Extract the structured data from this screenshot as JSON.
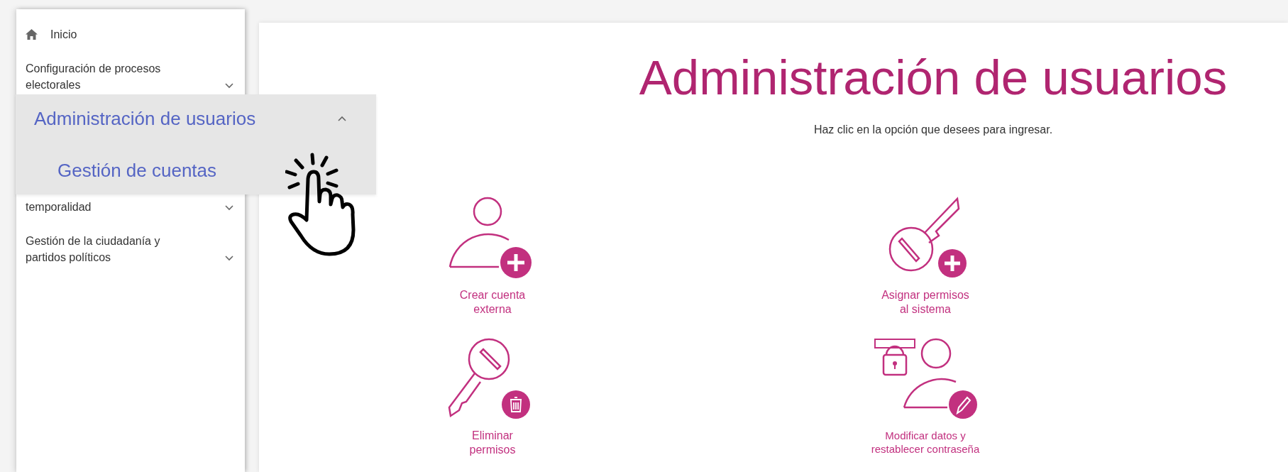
{
  "sidebar": {
    "items": [
      {
        "label": "Inicio",
        "kind": "home"
      },
      {
        "label": "Configuración de procesos electorales",
        "kind": "group",
        "expanded": false
      },
      {
        "label": "temporalidad",
        "kind": "covered-group",
        "expanded": false
      },
      {
        "label": "Gestión de la ciudadanía y partidos políticos",
        "kind": "group",
        "expanded": false
      }
    ]
  },
  "zoom_callout": {
    "item": {
      "label": "Administración de usuarios",
      "expanded": true
    },
    "subitems": [
      {
        "label": "Gestión de cuentas"
      }
    ]
  },
  "main": {
    "title": "Administración de usuarios",
    "subtitle": "Haz clic en la opción que desees para ingresar.",
    "options": [
      {
        "label": "Crear cuenta\nexterna",
        "kind": "user-add"
      },
      {
        "label": "Asignar permisos\nal sistema",
        "kind": "key-add"
      },
      {
        "label": "Eliminar\npermisos",
        "kind": "key-delete"
      },
      {
        "label": "Modificar datos y\nrestablecer contraseña",
        "kind": "user-edit"
      }
    ]
  }
}
